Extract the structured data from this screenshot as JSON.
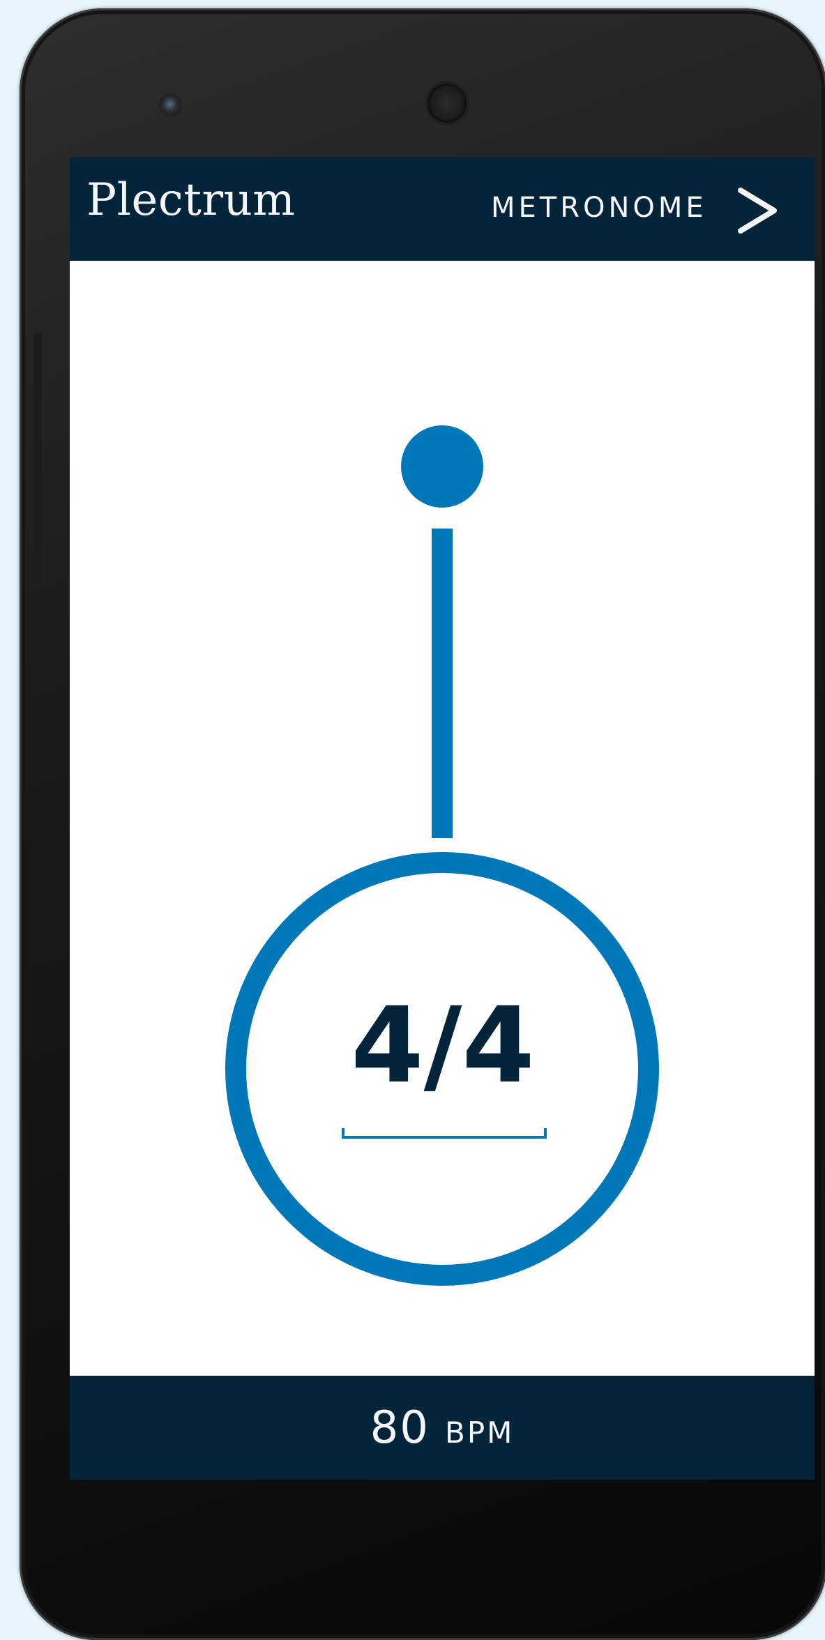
{
  "app": {
    "logo": "Plectrum",
    "section_title": "METRONOME",
    "next_icon": "chevron-right-icon"
  },
  "metronome": {
    "time_signature": "4/4"
  },
  "tempo": {
    "value": "80",
    "unit": "BPM"
  },
  "colors": {
    "bar_background": "#04243a",
    "accent_blue": "#0077b6",
    "screen_background": "#ffffff",
    "page_background": "#e6f6fc"
  }
}
